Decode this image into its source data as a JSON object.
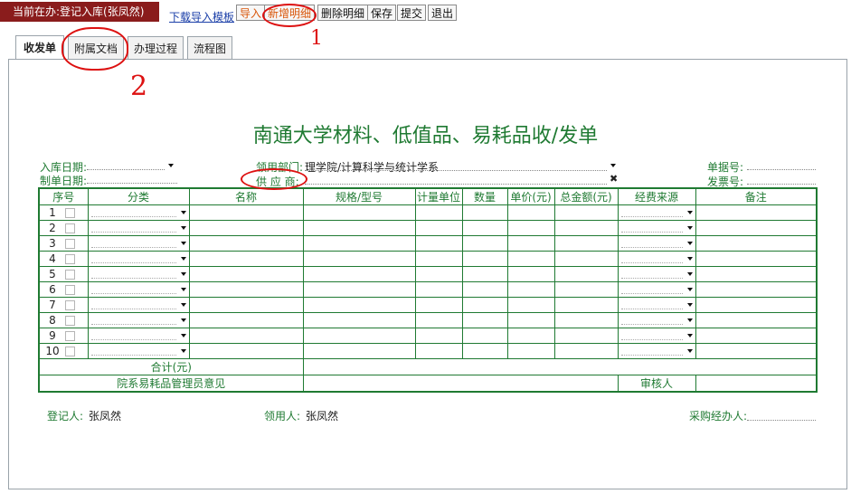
{
  "topbar": {
    "current_task": "当前在办:登记入库(张凤然)",
    "download_link": "下载导入模板",
    "buttons": [
      "导入",
      "新增明细",
      "删除明细",
      "保存",
      "提交",
      "退出"
    ]
  },
  "tabs": [
    "收发单",
    "附属文档",
    "办理过程",
    "流程图"
  ],
  "form": {
    "title": "南通大学材料、低值品、易耗品收/发单",
    "labels": {
      "in_date": "入库日期:",
      "make_date": "制单日期:",
      "dept": "领用部门:",
      "supplier": "供 应 商:",
      "doc_no": "单据号:",
      "invoice_no": "发票号:"
    },
    "values": {
      "dept": "理学院/计算科学与统计学系"
    },
    "table": {
      "headers": [
        "序号",
        "分类",
        "名称",
        "规格/型号",
        "计量单位",
        "数量",
        "单价(元)",
        "总金额(元)",
        "经费来源",
        "备注"
      ],
      "rows": [
        "1",
        "2",
        "3",
        "4",
        "5",
        "6",
        "7",
        "8",
        "9",
        "10"
      ],
      "sum_label": "合计(元)",
      "opinion_label": "院系易耗品管理员意见",
      "reviewer_label": "审核人"
    },
    "footer": {
      "registrar_label": "登记人:",
      "registrar_value": "张凤然",
      "receiver_label": "领用人:",
      "receiver_value": "张凤然",
      "buyer_label": "采购经办人:"
    }
  },
  "annotations": [
    "1",
    "2"
  ],
  "colors": {
    "header_bg": "#8a1c1c",
    "form_green": "#1f7a32",
    "annotation_red": "#dd1111",
    "link_blue": "#1b3fa8"
  }
}
